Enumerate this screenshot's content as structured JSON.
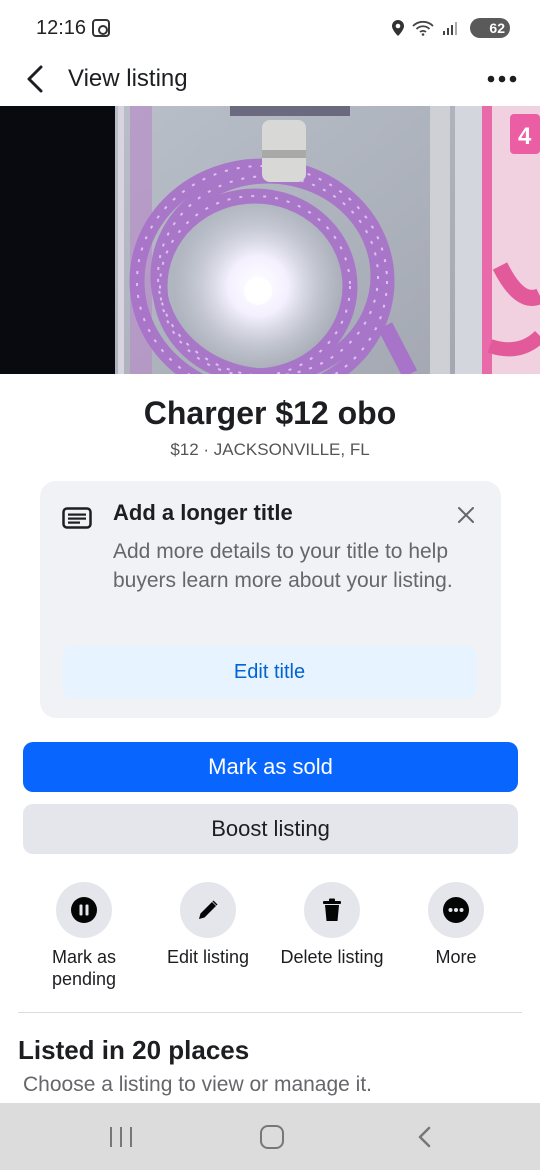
{
  "status_bar": {
    "time": "12:16",
    "battery": "62"
  },
  "header": {
    "title": "View listing"
  },
  "listing": {
    "title": "Charger $12 obo",
    "subtitle": "$12 · JACKSONVILLE, FL"
  },
  "tip": {
    "title": "Add a longer title",
    "body": "Add more details to your title to help buyers learn more about your listing.",
    "button": "Edit title"
  },
  "buttons": {
    "mark_sold": "Mark as sold",
    "boost": "Boost listing"
  },
  "actions": [
    {
      "label": "Mark as pending",
      "icon": "pause-icon"
    },
    {
      "label": "Edit listing",
      "icon": "pencil-icon"
    },
    {
      "label": "Delete listing",
      "icon": "trash-icon"
    },
    {
      "label": "More",
      "icon": "more-horizontal-icon"
    }
  ],
  "section": {
    "title": "Listed in 20 places",
    "subtitle": "Choose a listing to view or manage it."
  },
  "colors": {
    "primary": "#0866ff",
    "secondary_bg": "#e4e6eb",
    "tip_bg": "#f0f2f5",
    "link_blue": "#0064d1"
  }
}
